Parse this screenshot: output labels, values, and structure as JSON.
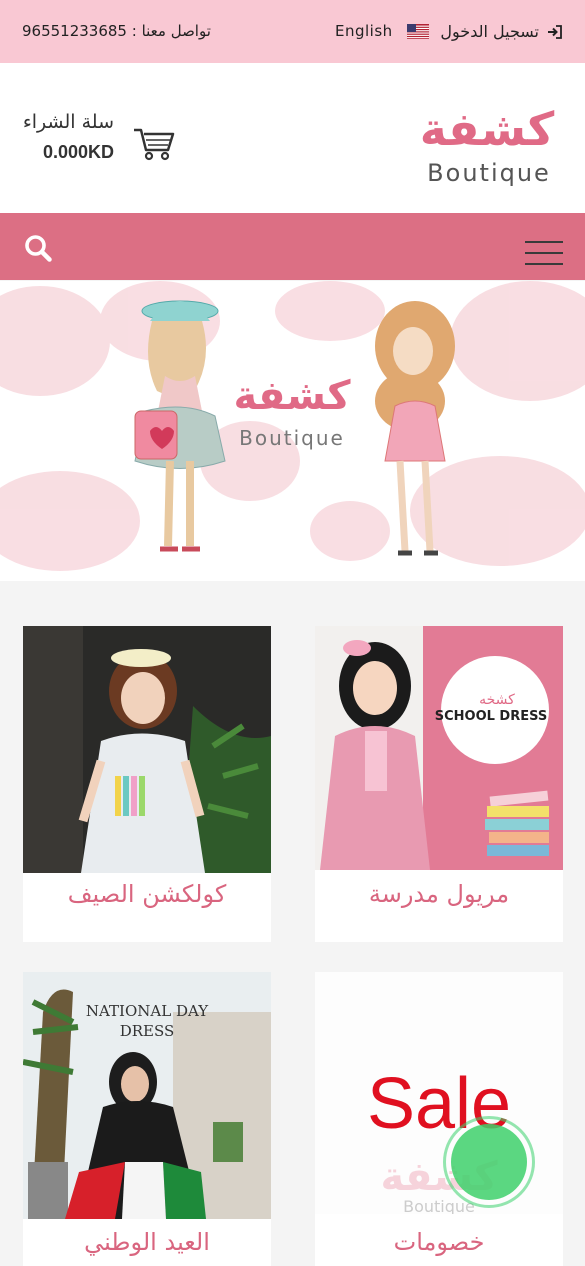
{
  "topbar": {
    "login_label": "تسجيل الدخول",
    "language_label": "English",
    "contact_label": "تواصل معنا : 96551233685"
  },
  "header": {
    "logo_arabic": "كشفة",
    "logo_latin": "Boutique",
    "cart_title": "سلة الشراء",
    "cart_total": "0.000KD"
  },
  "banner": {
    "logo_arabic": "كشفة",
    "logo_latin": "Boutique"
  },
  "categories": [
    {
      "label": "مريول مدرسة",
      "image_text": "كشخه",
      "image_text2": "SCHOOL DRESS"
    },
    {
      "label": "كولكشن الصيف"
    },
    {
      "label": "خصومات",
      "image_text": "Sale",
      "image_text2": "كشفة",
      "image_text3": "Boutique"
    },
    {
      "label": "العيد الوطني",
      "image_text": "NATIONAL DAY",
      "image_text2": "DRESS"
    }
  ],
  "colors": {
    "topbar_bg": "#f9c8d3",
    "nav_bg": "#dc6f84",
    "accent_pink": "#d9657f",
    "sale_red": "#e01020"
  }
}
